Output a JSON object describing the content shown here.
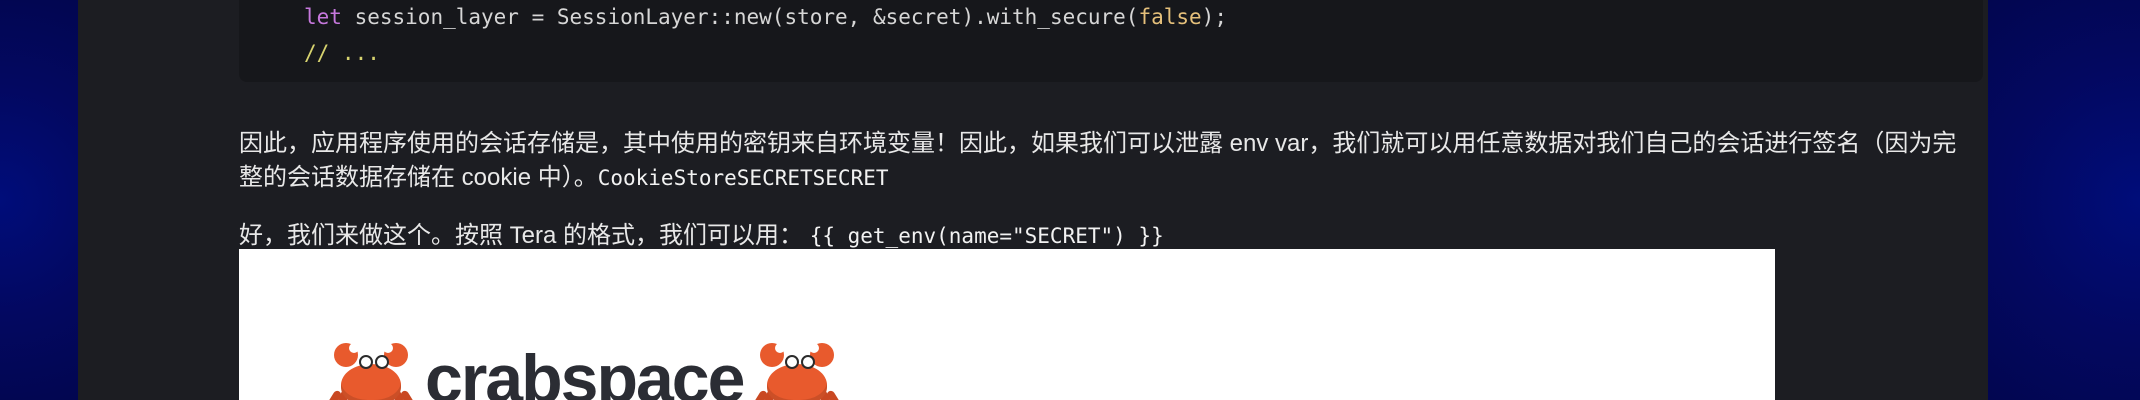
{
  "code": {
    "line1_keyword": "let",
    "line1_rest": " session_layer = SessionLayer::new(store, &secret).with_secure(",
    "line1_bool": "false",
    "line1_end": ");",
    "line2_comment": "// ..."
  },
  "paragraphs": {
    "p1_text": "因此，应用程序使用的会话存储是，其中使用的密钥来自环境变量！因此，如果我们可以泄露 env var，我们就可以用任意数据对我们自己的会话进行签名（因为完整的会话数据存储在 cookie 中）。",
    "p1_code": "CookieStoreSECRETSECRET",
    "p2_text": "好，我们来做这个。按照 Tera 的格式，我们可以用：",
    "p2_code": "{{ get_env(name=\"SECRET\") }}"
  },
  "preview": {
    "logo_text": "crabspace",
    "left_icon": "crab-icon",
    "right_icon": "crab-icon"
  },
  "colors": {
    "outer_background": "#04085a",
    "panel_background": "#1c1d22",
    "code_background": "#16171b",
    "keyword": "#c678dd",
    "boolean": "#e5c07b",
    "comment": "#d7d36f",
    "logo_crab": "#e85a2d"
  }
}
